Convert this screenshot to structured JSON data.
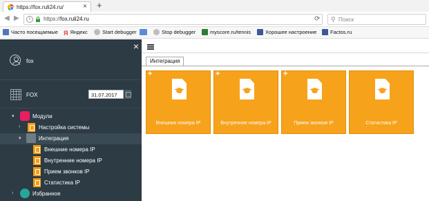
{
  "browser": {
    "tab_title": "https://fox.ruli24.ru/",
    "tab_close": "×",
    "new_tab": "+",
    "url_prefix": "https://",
    "url_host": "fox.ruli24.ru",
    "search_placeholder": "Поиск",
    "bookmarks": [
      {
        "label": "Часто посещаемые",
        "icon": "bookmark-star-icon",
        "color": "#4a7ab5"
      },
      {
        "label": "Яндекс",
        "icon": "yandex-icon",
        "color": "#e53935"
      },
      {
        "label": "Start debugger",
        "icon": "globe-icon",
        "color": "#9e9e9e"
      },
      {
        "label": "",
        "icon": "flag-icon",
        "color": "#5b8dd6"
      },
      {
        "label": "Stop debugger",
        "icon": "globe-icon",
        "color": "#9e9e9e"
      },
      {
        "label": "myscore.ru/tennis",
        "icon": "myscore-icon",
        "color": "#2e7d32"
      },
      {
        "label": "Хорошее настроение",
        "icon": "facebook-icon",
        "color": "#3b5998"
      },
      {
        "label": "Factos.ru",
        "icon": "facebook-icon",
        "color": "#3b5998"
      }
    ]
  },
  "sidebar": {
    "close": "×",
    "user_name": "fox",
    "org_name": "FOX",
    "date": "31.07.2017",
    "tree": {
      "modules": "Модули",
      "system_settings": "Настройка системы",
      "integration": "Интеграция",
      "leaves": [
        "Внешние номера IP",
        "Внутренние номера IP",
        "Прием звонков IP",
        "Статистика IP"
      ],
      "favorites": "Избранное"
    }
  },
  "main": {
    "tab_label": "Интеграция",
    "tiles": [
      {
        "label": "Внешние номера IP",
        "plus": "+"
      },
      {
        "label": "Внутренние номера IP",
        "plus": "+"
      },
      {
        "label": "Прием звонков IP",
        "plus": "+"
      },
      {
        "label": "Статистика IP",
        "plus": ""
      }
    ]
  },
  "colors": {
    "sidebar_bg": "#2d3b45",
    "tile_orange": "#f7a21b",
    "modules_icon": "#e91e63",
    "favorites_icon": "#26a69a"
  }
}
